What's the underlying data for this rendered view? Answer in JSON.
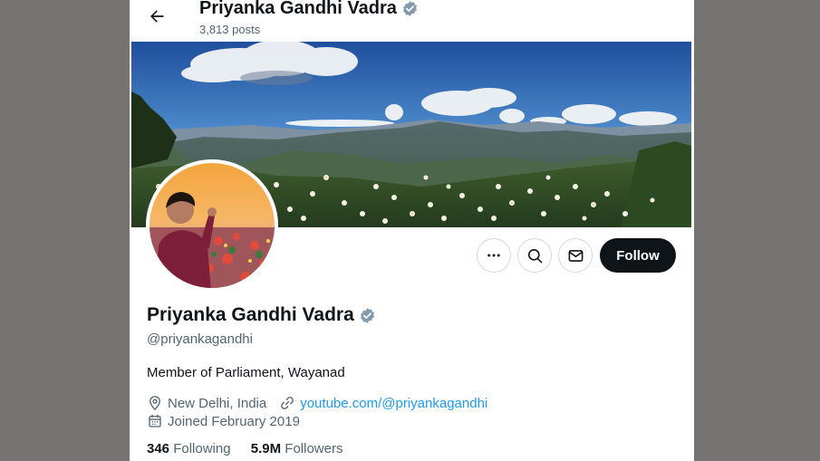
{
  "header": {
    "name": "Priyanka Gandhi Vadra",
    "posts": "3,813 posts"
  },
  "profile": {
    "name": "Priyanka Gandhi Vadra",
    "handle": "@priyankagandhi",
    "bio": "Member of Parliament, Wayanad",
    "location": "New Delhi, India",
    "website": "youtube.com/@priyankagandhi",
    "joined": "Joined February 2019",
    "following_count": "346",
    "following_label": "Following",
    "followers_count": "5.9M",
    "followers_label": "Followers"
  },
  "actions": {
    "follow_label": "Follow"
  },
  "icons": [
    "back-arrow-icon",
    "verified-badge-icon",
    "more-icon",
    "search-icon",
    "mail-icon",
    "location-icon",
    "link-icon",
    "calendar-icon"
  ],
  "colors": {
    "background": "#757472",
    "accent": "#1d9bf0",
    "verified": "#829aab",
    "text": "#0f1419",
    "muted": "#536471",
    "follow_button": "#0f1419"
  }
}
